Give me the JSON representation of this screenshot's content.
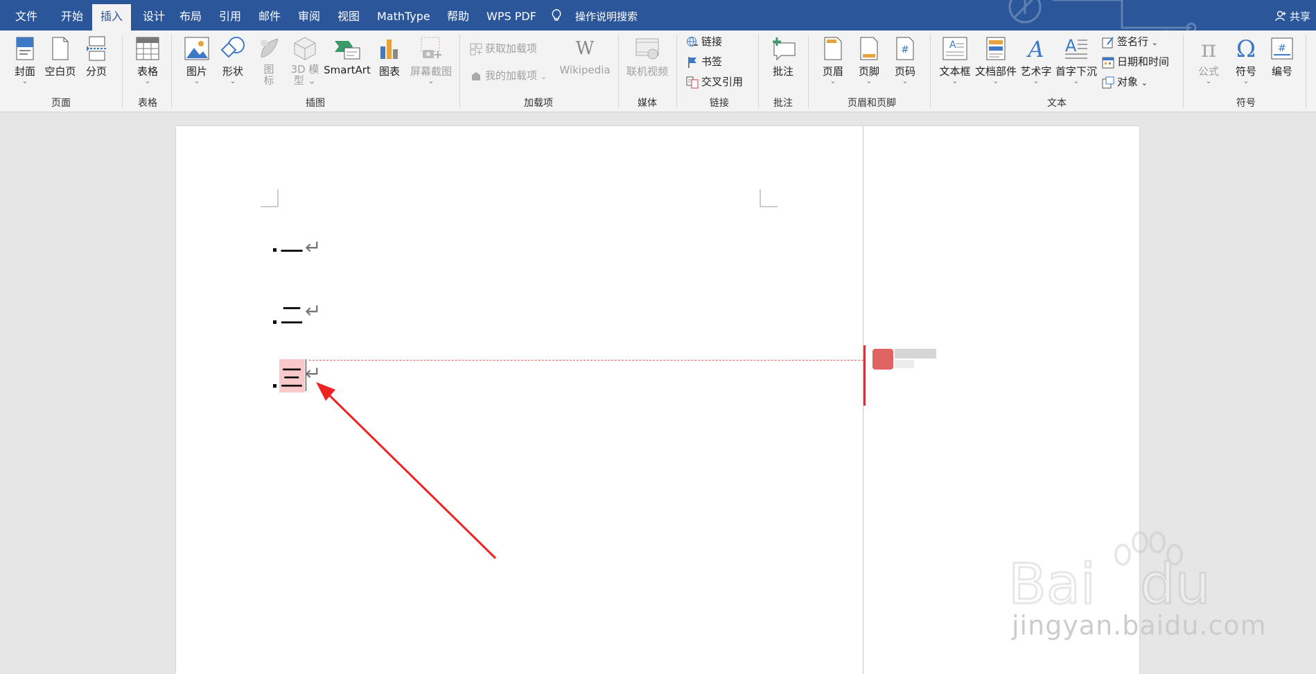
{
  "tabs": [
    "文件",
    "开始",
    "插入",
    "设计",
    "布局",
    "引用",
    "邮件",
    "审阅",
    "视图",
    "MathType",
    "帮助",
    "WPS PDF"
  ],
  "active_tab": "插入",
  "tell_me": "操作说明搜索",
  "share": "共享",
  "ribbon": {
    "pages": {
      "cover": "封面",
      "blank": "空白页",
      "break": "分页",
      "group": "页面"
    },
    "tables": {
      "table": "表格",
      "group": "表格"
    },
    "illustrations": {
      "picture": "图片",
      "shapes": "形状",
      "icons_l1": "图",
      "icons_l2": "标",
      "model_l1": "3D 模",
      "model_l2": "型",
      "smartart": "SmartArt",
      "chart": "图表",
      "screenshot": "屏幕截图",
      "group": "插图"
    },
    "addins": {
      "get": "获取加载项",
      "mine": "我的加载项",
      "wiki": "Wikipedia",
      "group": "加载项"
    },
    "media": {
      "video": "联机视频",
      "group": "媒体"
    },
    "links": {
      "link": "链接",
      "bookmark": "书签",
      "crossref": "交叉引用",
      "group": "链接"
    },
    "comments": {
      "comment": "批注",
      "group": "批注"
    },
    "header_footer": {
      "header": "页眉",
      "footer": "页脚",
      "page_number": "页码",
      "group": "页眉和页脚"
    },
    "text": {
      "textbox": "文本框",
      "quickparts": "文档部件",
      "wordart": "艺术字",
      "dropcap": "首字下沉",
      "signature": "签名行",
      "datetime": "日期和时间",
      "object": "对象",
      "group": "文本"
    },
    "symbols": {
      "equation": "公式",
      "symbol": "符号",
      "numbering": "编号",
      "group": "符号"
    }
  },
  "document": {
    "paragraphs": [
      "一",
      "二",
      "三"
    ],
    "return_mark": "↵"
  },
  "watermark": {
    "text": "jingyan.baidu.com"
  },
  "colors": {
    "title_bar": "#2b579a",
    "ribbon": "#f3f3f3",
    "highlight": "#f7c9cb",
    "annotation": "#ee2222",
    "comment": "#d0343c"
  }
}
